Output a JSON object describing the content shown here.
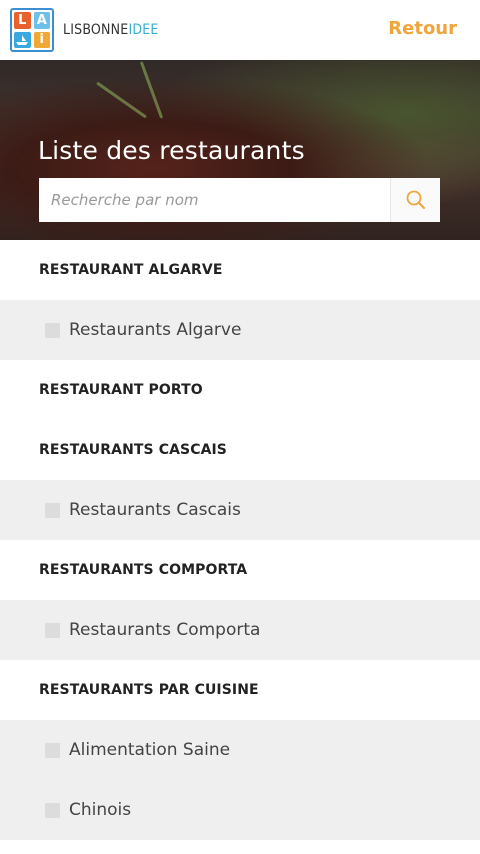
{
  "header": {
    "logo_letters": [
      "L",
      "A",
      "",
      "i"
    ],
    "brand_part1": "LISBONNE",
    "brand_part2": "IDEE",
    "back_label": "Retour",
    "accent_color": "#f0a53a"
  },
  "hero": {
    "title": "Liste des restaurants",
    "search_placeholder": "Recherche par nom",
    "search_icon": "search-icon"
  },
  "list": [
    {
      "type": "category",
      "label": "RESTAURANT ALGARVE"
    },
    {
      "type": "item",
      "label": "Restaurants Algarve"
    },
    {
      "type": "category",
      "label": "RESTAURANT PORTO"
    },
    {
      "type": "category",
      "label": "RESTAURANTS CASCAIS"
    },
    {
      "type": "item",
      "label": "Restaurants Cascais"
    },
    {
      "type": "category",
      "label": "RESTAURANTS COMPORTA"
    },
    {
      "type": "item",
      "label": "Restaurants Comporta"
    },
    {
      "type": "category",
      "label": "RESTAURANTS PAR CUISINE"
    },
    {
      "type": "item",
      "label": "Alimentation Saine"
    },
    {
      "type": "item",
      "label": "Chinois"
    }
  ]
}
